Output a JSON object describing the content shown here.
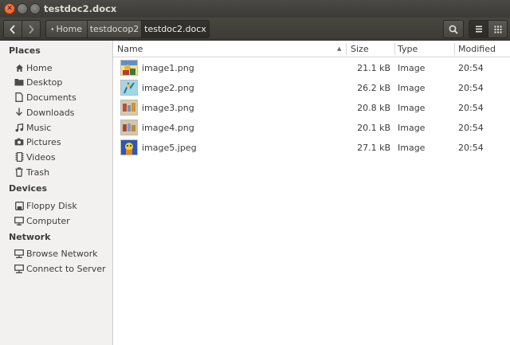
{
  "window": {
    "title": "testdoc2.docx"
  },
  "toolbar": {
    "breadcrumbs": [
      {
        "label": "Home",
        "icon": "home-icon"
      },
      {
        "label": "testdocop2"
      },
      {
        "label": "testdoc2.docx"
      }
    ]
  },
  "sidebar": {
    "sections": [
      {
        "heading": "Places",
        "items": [
          {
            "label": "Home",
            "icon": "home-icon"
          },
          {
            "label": "Desktop",
            "icon": "folder-icon"
          },
          {
            "label": "Documents",
            "icon": "document-icon"
          },
          {
            "label": "Downloads",
            "icon": "download-icon"
          },
          {
            "label": "Music",
            "icon": "music-icon"
          },
          {
            "label": "Pictures",
            "icon": "camera-icon"
          },
          {
            "label": "Videos",
            "icon": "film-icon"
          },
          {
            "label": "Trash",
            "icon": "trash-icon"
          }
        ]
      },
      {
        "heading": "Devices",
        "items": [
          {
            "label": "Floppy Disk",
            "icon": "floppy-icon"
          },
          {
            "label": "Computer",
            "icon": "computer-icon"
          }
        ]
      },
      {
        "heading": "Network",
        "items": [
          {
            "label": "Browse Network",
            "icon": "network-icon"
          },
          {
            "label": "Connect to Server",
            "icon": "server-icon"
          }
        ]
      }
    ]
  },
  "columns": {
    "name": "Name",
    "size": "Size",
    "type": "Type",
    "modified": "Modified"
  },
  "files": [
    {
      "name": "image1.png",
      "size": "21.1 kB",
      "type": "Image",
      "modified": "20:54"
    },
    {
      "name": "image2.png",
      "size": "26.2 kB",
      "type": "Image",
      "modified": "20:54"
    },
    {
      "name": "image3.png",
      "size": "20.8 kB",
      "type": "Image",
      "modified": "20:54"
    },
    {
      "name": "image4.png",
      "size": "20.1 kB",
      "type": "Image",
      "modified": "20:54"
    },
    {
      "name": "image5.jpeg",
      "size": "27.1 kB",
      "type": "Image",
      "modified": "20:54"
    }
  ]
}
